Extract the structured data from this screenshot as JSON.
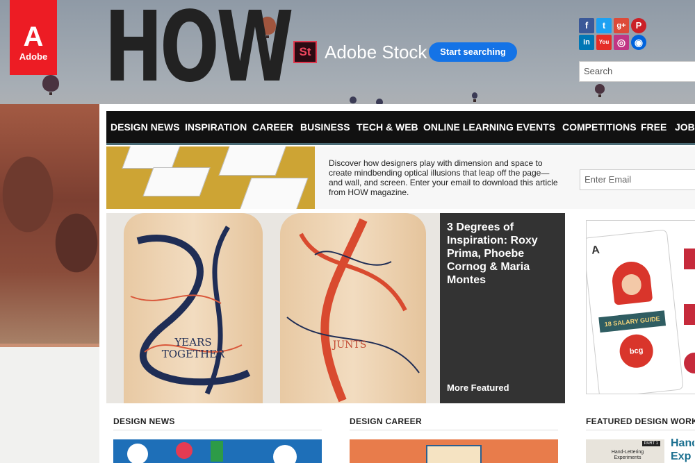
{
  "brand": {
    "adobe_mark": "A",
    "adobe_label": "Adobe",
    "how_logo": "HOW"
  },
  "adobe_stock": {
    "badge": "St",
    "name": "Adobe Stock",
    "cta": "Start searching"
  },
  "social": [
    {
      "name": "facebook-icon",
      "glyph": "f",
      "color": "#3b5998"
    },
    {
      "name": "twitter-icon",
      "glyph": "t",
      "color": "#1da1f2"
    },
    {
      "name": "google-plus-icon",
      "glyph": "g+",
      "color": "#dd4b39"
    },
    {
      "name": "pinterest-icon",
      "glyph": "P",
      "color": "#cb2027"
    },
    {
      "name": "linkedin-icon",
      "glyph": "in",
      "color": "#0077b5"
    },
    {
      "name": "youtube-icon",
      "glyph": "You",
      "color": "#e52d27"
    },
    {
      "name": "instagram-icon",
      "glyph": "◎",
      "color": "#c13584"
    },
    {
      "name": "flickr-icon",
      "glyph": "◉",
      "color": "#0063dc"
    }
  ],
  "search": {
    "placeholder": "Search"
  },
  "nav": {
    "items": [
      "DESIGN NEWS",
      "INSPIRATION",
      "CAREER",
      "BUSINESS",
      "TECH & WEB",
      "ONLINE LEARNING",
      "EVENTS",
      "COMPETITIONS",
      "FREE",
      "JOBS"
    ]
  },
  "promo": {
    "text": "Discover how designers play with dimension and space to create mindbending optical illusions that leap off the page—and wall, and screen. Enter your email to download this article from HOW magazine.",
    "email_placeholder": "Enter Email"
  },
  "featured": {
    "title": "3 Degrees of Inspiration: Roxy Prima, Phoebe Cornog & Maria Montes",
    "board_left_text": "YEARS TOGETHER",
    "board_right_text": "JUNTS",
    "more_label": "More Featured"
  },
  "ad": {
    "salary_label": "18 SALARY GUIDE",
    "brand_small": "bcg"
  },
  "sections": [
    {
      "label": "DESIGN NEWS"
    },
    {
      "label": "DESIGN CAREER"
    },
    {
      "label": "FEATURED DESIGN WORKS"
    }
  ],
  "featured_works_thumb": {
    "caption_1": "PART 1",
    "caption_2": "Hand-Lettering Experiments",
    "link_text": "Hand Exp"
  }
}
